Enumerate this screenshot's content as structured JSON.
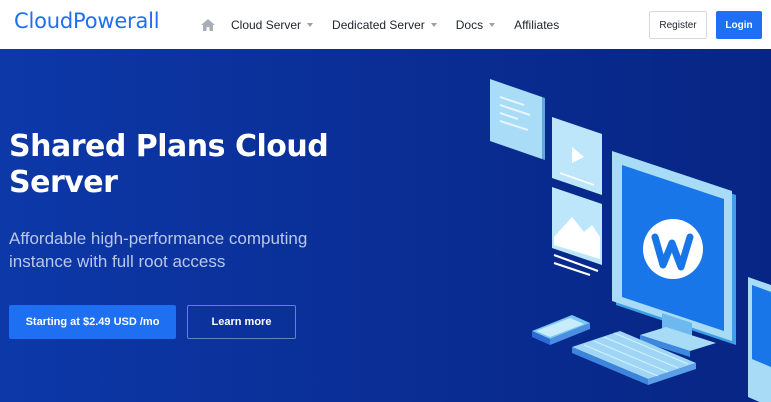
{
  "header": {
    "logo": "CloudPowerall",
    "nav": [
      {
        "label": "Cloud Server",
        "has_dropdown": true
      },
      {
        "label": "Dedicated Server",
        "has_dropdown": true
      },
      {
        "label": "Docs",
        "has_dropdown": true
      },
      {
        "label": "Affiliates",
        "has_dropdown": false
      }
    ],
    "home_icon": "home-icon",
    "register_label": "Register",
    "login_label": "Login"
  },
  "hero": {
    "title": "Shared Plans Cloud Server",
    "subtitle": "Affordable high-performance computing instance with full root access",
    "primary_cta": "Starting at $2.49 USD /mo",
    "secondary_cta": "Learn more",
    "illustration": "monitor-with-w-logo-illustration"
  },
  "colors": {
    "brand": "#1e6ff1",
    "hero_bg": "#0a2f97",
    "header_bg": "#ffffff"
  }
}
